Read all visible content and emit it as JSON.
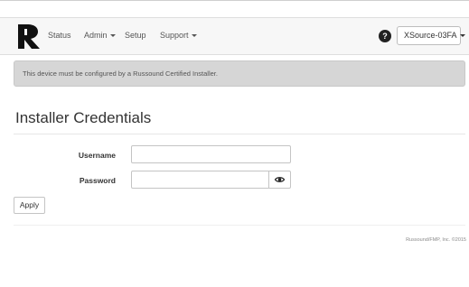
{
  "nav": {
    "items": [
      {
        "label": "Status",
        "dropdown": false
      },
      {
        "label": "Admin",
        "dropdown": true
      },
      {
        "label": "Setup",
        "dropdown": false
      },
      {
        "label": "Support",
        "dropdown": true
      }
    ],
    "help_icon": "question-icon",
    "help_symbol": "?",
    "device_label": "XSource-03FA"
  },
  "alert": {
    "text": "This device must be configured by a Russound Certified Installer."
  },
  "page": {
    "title": "Installer Credentials"
  },
  "form": {
    "username_label": "Username",
    "username_value": "",
    "password_label": "Password",
    "password_value": "",
    "show_password_icon": "eye-icon",
    "apply_label": "Apply"
  },
  "footer": {
    "text": "Russound/FMP, Inc. ©2015"
  },
  "colors": {
    "navbar_bg": "#f7f7f7",
    "alert_bg": "#d6d6d6",
    "logo": "#111111"
  }
}
